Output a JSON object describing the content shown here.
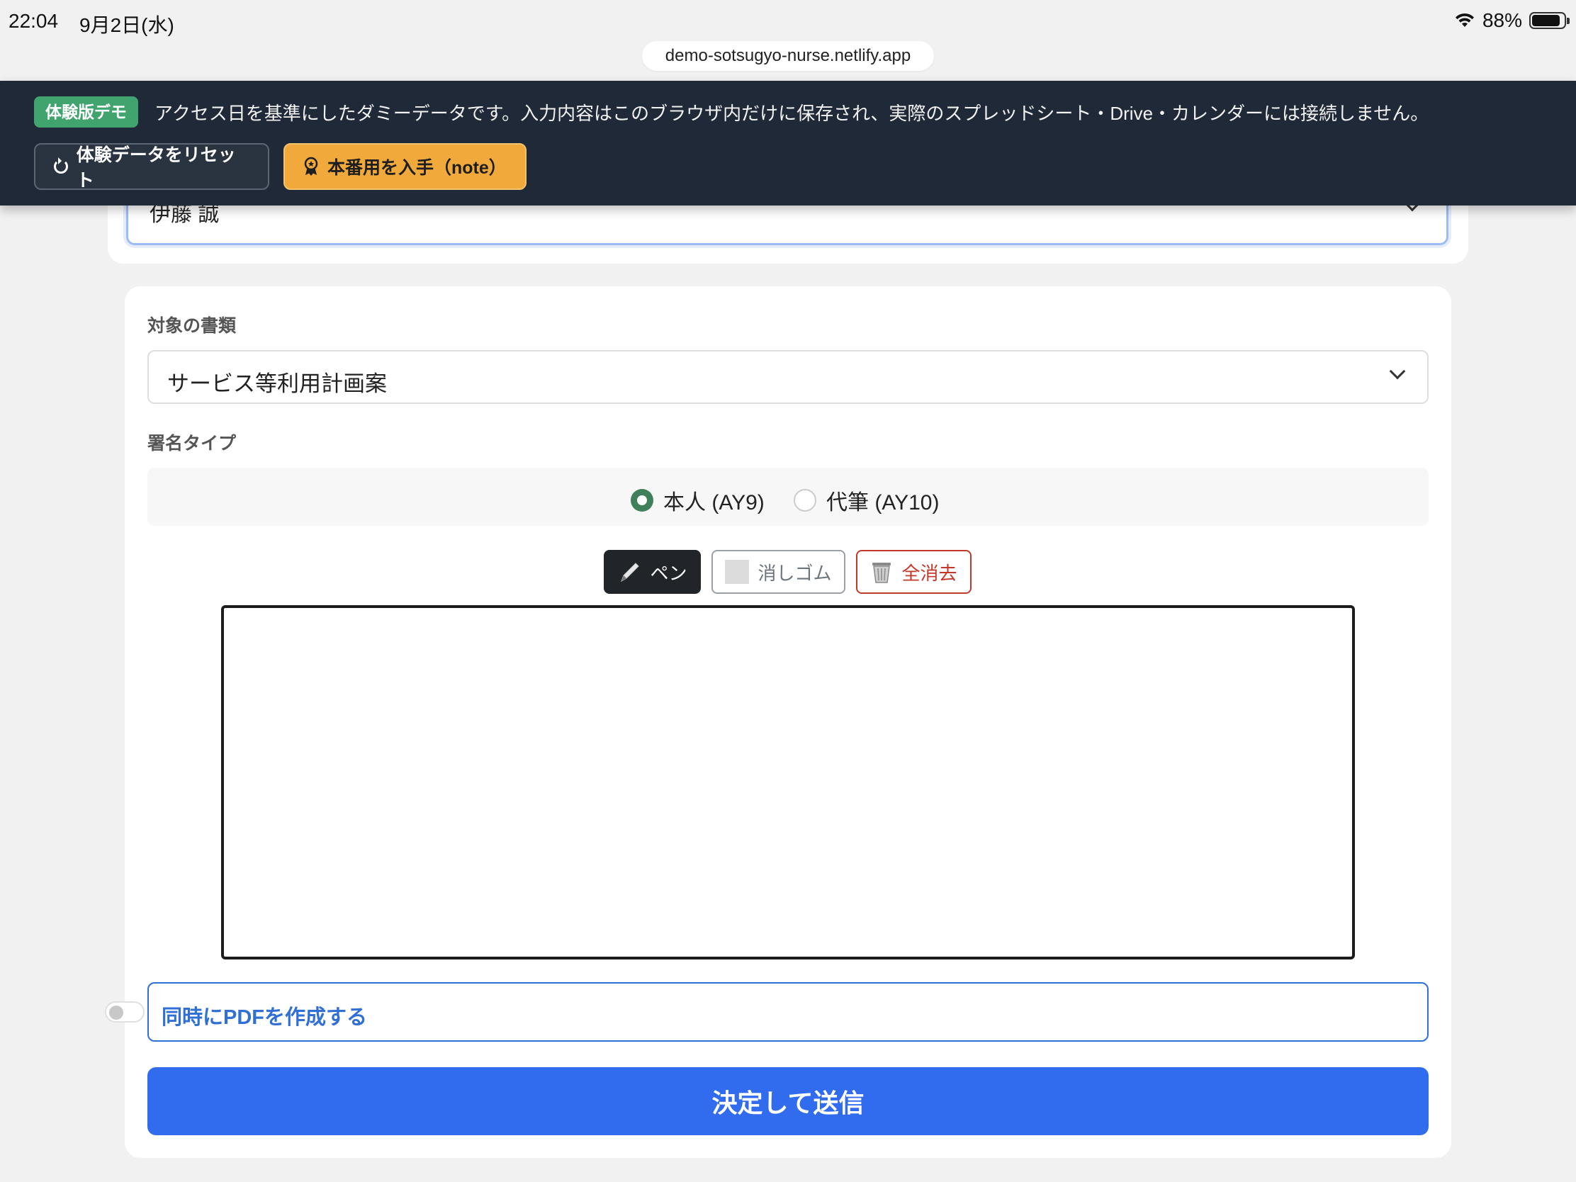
{
  "status_bar": {
    "time": "22:04",
    "date": "9月2日(水)",
    "battery": "88%",
    "battery_level": 0.88
  },
  "browser": {
    "url": "demo-sotsugyo-nurse.netlify.app"
  },
  "banner": {
    "badge": "体験版デモ",
    "message": "アクセス日を基準にしたダミーデータです。入力内容はこのブラウザ内だけに保存され、実際のスプレッドシート・Drive・カレンダーには接続しません。",
    "reset_label": "体験データをリセット",
    "note_label": "本番用を入手（note）"
  },
  "staff_select": {
    "value": "伊藤 誠"
  },
  "form": {
    "document_label": "対象の書類",
    "document_value": "サービス等利用計画案",
    "signature_type_label": "署名タイプ",
    "signature_options": [
      {
        "label": "本人 (AY9)",
        "selected": true
      },
      {
        "label": "代筆 (AY10)",
        "selected": false
      }
    ],
    "tools": {
      "pen": "ペン",
      "eraser": "消しゴム",
      "clear": "全消去"
    },
    "pdf_toggle_label": "同時にPDFを作成する",
    "pdf_toggle_on": false,
    "submit_label": "決定して送信"
  },
  "colors": {
    "banner_bg": "#1f2937",
    "badge_green": "#41a36e",
    "note_orange": "#f0a93a",
    "primary_blue": "#316cee",
    "radio_green": "#3f7f5a",
    "danger_red": "#c0392b"
  },
  "icons": [
    "wifi-icon",
    "battery-icon",
    "reset-icon",
    "award-icon",
    "chevron-down-icon",
    "pen-icon",
    "eraser-icon",
    "trash-icon"
  ]
}
